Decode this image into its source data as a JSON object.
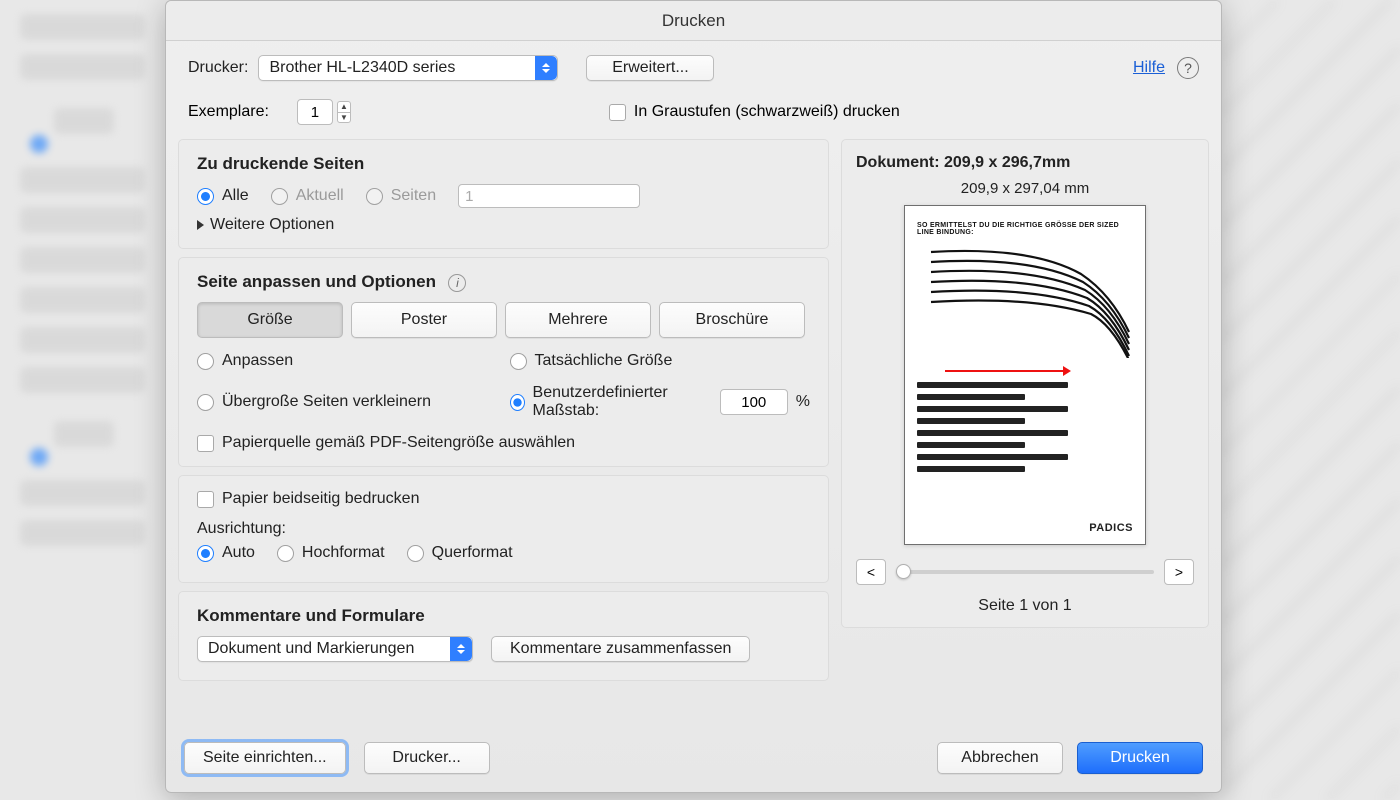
{
  "title": "Drucken",
  "top": {
    "printer_label": "Drucker:",
    "printer_value": "Brother HL-L2340D series",
    "advanced_btn": "Erweitert...",
    "help_link": "Hilfe",
    "copies_label": "Exemplare:",
    "copies_value": "1",
    "grayscale_label": "In Graustufen (schwarzweiß) drucken"
  },
  "pages": {
    "heading": "Zu druckende Seiten",
    "all": "Alle",
    "current": "Aktuell",
    "range_label": "Seiten",
    "range_value": "1",
    "more": "Weitere Optionen"
  },
  "fit": {
    "heading": "Seite anpassen und Optionen",
    "tabs": {
      "size": "Größe",
      "poster": "Poster",
      "multiple": "Mehrere",
      "booklet": "Broschüre"
    },
    "fit_opt": "Anpassen",
    "actual_opt": "Tatsächliche Größe",
    "shrink_opt": "Übergroße Seiten verkleinern",
    "custom_opt": "Benutzerdefinierter Maßstab:",
    "custom_value": "100",
    "pct": "%",
    "paper_source": "Papierquelle gemäß PDF-Seitengröße auswählen"
  },
  "duplex": {
    "label": "Papier beidseitig bedrucken"
  },
  "orient": {
    "heading": "Ausrichtung:",
    "auto": "Auto",
    "portrait": "Hochformat",
    "landscape": "Querformat"
  },
  "comments": {
    "heading": "Kommentare und Formulare",
    "select_value": "Dokument und Markierungen",
    "summarize_btn": "Kommentare zusammenfassen"
  },
  "preview": {
    "doc_label": "Dokument: 209,9 x 296,7mm",
    "dim": "209,9 x 297,04 mm",
    "page_title": "SO ERMITTELST DU DIE RICHTIGE GRÖSSE DER SIZED LINE BINDUNG:",
    "logo": "PADICS",
    "prev": "<",
    "next": ">",
    "counter": "Seite 1 von 1"
  },
  "footer": {
    "page_setup": "Seite einrichten...",
    "printer_btn": "Drucker...",
    "cancel": "Abbrechen",
    "print": "Drucken"
  }
}
